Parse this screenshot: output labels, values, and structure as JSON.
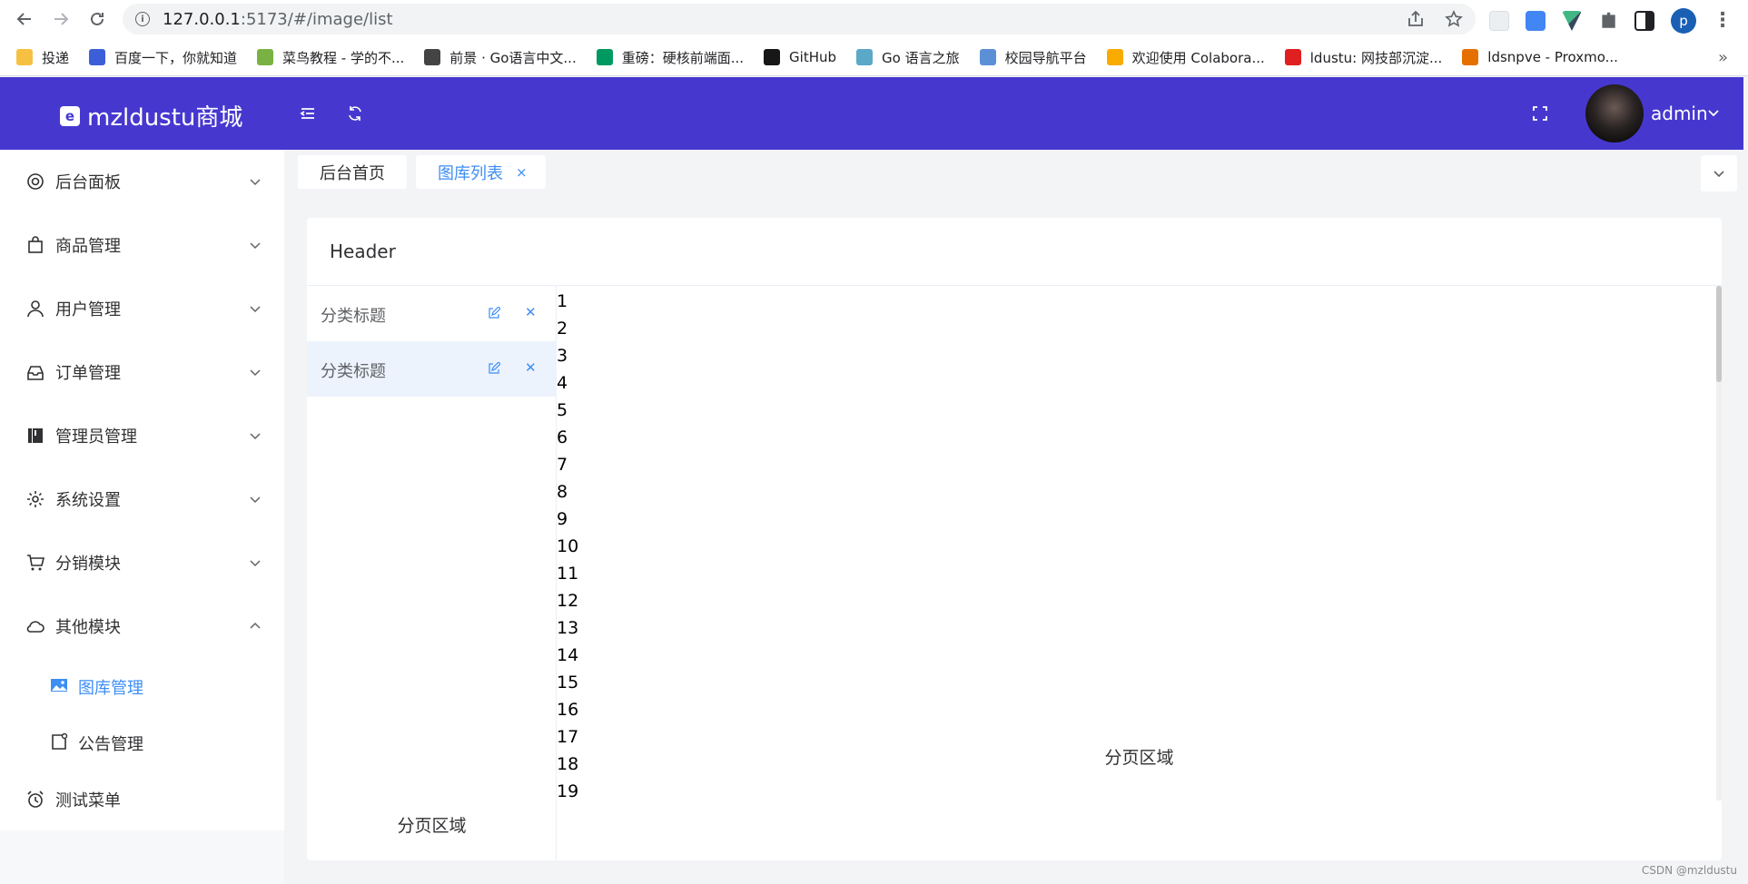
{
  "browser": {
    "url_host": "127.0.0.1",
    "url_path": ":5173/#/image/list",
    "profile_initial": "p",
    "bookmarks": [
      {
        "label": "投递",
        "icon": "folder-icon",
        "color": "#f6c142"
      },
      {
        "label": "百度一下，你就知道",
        "icon": "baidu-icon",
        "color": "#3c5fd8"
      },
      {
        "label": "菜鸟教程 - 学的不...",
        "icon": "runoob-icon",
        "color": "#78b243"
      },
      {
        "label": "前景 · Go语言中文...",
        "icon": "book-icon",
        "color": "#444444"
      },
      {
        "label": "重磅：硬核前端面...",
        "icon": "segmentfault-icon",
        "color": "#009a61"
      },
      {
        "label": "GitHub",
        "icon": "github-icon",
        "color": "#181717"
      },
      {
        "label": "Go 语言之旅",
        "icon": "gopher-icon",
        "color": "#5ba8c9"
      },
      {
        "label": "校园导航平台",
        "icon": "campus-icon",
        "color": "#5b8fd6"
      },
      {
        "label": "欢迎使用 Colabora...",
        "icon": "colab-icon",
        "color": "#f9ab00"
      },
      {
        "label": "ldustu: 网技部沉淀...",
        "icon": "gitlab-like-icon",
        "color": "#e02020"
      },
      {
        "label": "ldsnpve - Proxmo...",
        "icon": "proxmox-icon",
        "color": "#e57000"
      }
    ]
  },
  "header": {
    "brand": "mzldustu商城",
    "brand_logo": "e",
    "user": "admin"
  },
  "sidebar": {
    "items": [
      {
        "label": "后台面板",
        "icon": "dashboard-icon"
      },
      {
        "label": "商品管理",
        "icon": "shopping-bag-icon"
      },
      {
        "label": "用户管理",
        "icon": "user-icon"
      },
      {
        "label": "订单管理",
        "icon": "inbox-icon"
      },
      {
        "label": "管理员管理",
        "icon": "notebook-icon"
      },
      {
        "label": "系统设置",
        "icon": "gear-icon"
      },
      {
        "label": "分销模块",
        "icon": "cart-icon"
      },
      {
        "label": "其他模块",
        "icon": "cloud-icon"
      }
    ],
    "sub_items": [
      {
        "label": "图库管理",
        "icon": "picture-icon",
        "active": true
      },
      {
        "label": "公告管理",
        "icon": "notice-icon",
        "active": false
      }
    ],
    "last_item": {
      "label": "测试菜单",
      "icon": "alarm-clock-icon"
    }
  },
  "tabs": [
    {
      "label": "后台首页",
      "active": false
    },
    {
      "label": "图库列表",
      "active": true,
      "close": "×"
    }
  ],
  "card": {
    "header": "Header",
    "categories": [
      {
        "label": "分类标题",
        "active": false
      },
      {
        "label": "分类标题",
        "active": true
      }
    ],
    "pager_left": "分页区域",
    "pager_right": "分页区域",
    "list": [
      "1",
      "2",
      "3",
      "4",
      "5",
      "6",
      "7",
      "8",
      "9",
      "10",
      "11",
      "12",
      "13",
      "14",
      "15",
      "16",
      "17",
      "18",
      "19"
    ]
  },
  "watermark": "CSDN @mzldustu",
  "colors": {
    "header_bg": "#4638cf",
    "accent": "#3d8ef5",
    "active_row": "#ecf3fd"
  }
}
